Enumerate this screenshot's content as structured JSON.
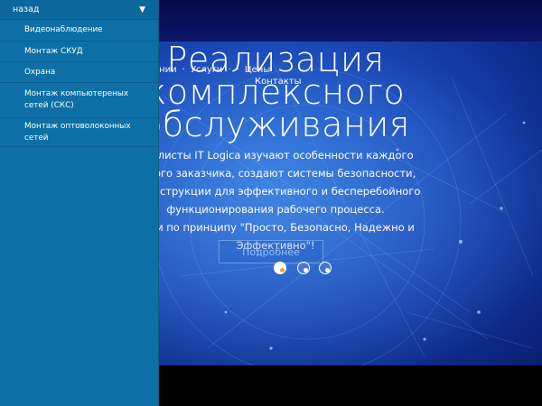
{
  "sidebar": {
    "back_label": "назад",
    "items": [
      {
        "label": "Видеонаблюдение"
      },
      {
        "label": "Монтаж СКУД"
      },
      {
        "label": "Охрана"
      },
      {
        "label": "Монтаж компьютереных сетей (СКС)"
      },
      {
        "label": "Монтаж оптоволоконных сетей"
      }
    ]
  },
  "nav": {
    "links": [
      "ании",
      "·",
      "Услуги",
      "·",
      "·",
      "Цены"
    ],
    "contacts": "Контакты"
  },
  "hero": {
    "title_lines": [
      "Реализация",
      "комплексного",
      "обслуживания"
    ],
    "text_lines": [
      "циалисты IT Logica изучают особенности каждого",
      "етного заказчика, создают системы безопасности,",
      "от инструкции для эффективного и бесперебойного",
      "функционирования рабочего процесса.",
      "таем по принципу \"Просто, Безопасно, Надежно и",
      "Эффективно\"!"
    ],
    "button_label": "Подробнее"
  },
  "colors": {
    "sidebar": "#0d6fa6",
    "dot_accent_1": "#f0a030",
    "dot_accent_2": "#3a6fd8"
  }
}
